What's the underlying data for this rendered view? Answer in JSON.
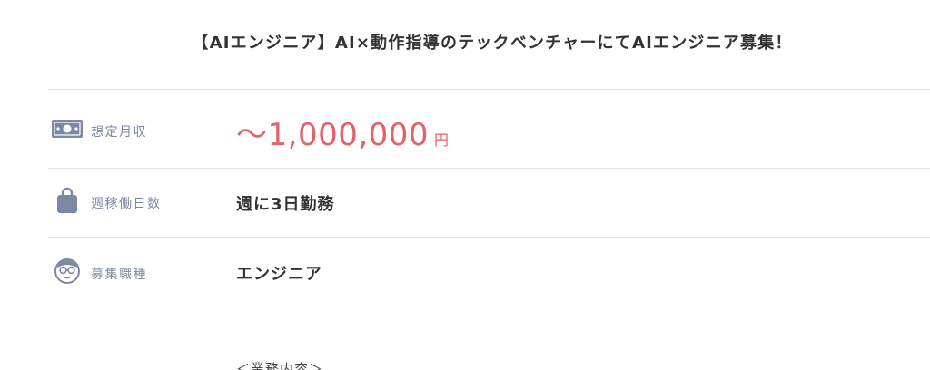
{
  "job_title": "【AIエンジニア】AI×動作指導のテックベンチャーにてAIエンジニア募集！",
  "details": {
    "salary": {
      "label": "想定月収",
      "amount": "〜1,000,000",
      "unit": "円",
      "icon": "money-bill-icon"
    },
    "working_days": {
      "label": "週稼働日数",
      "value": "週に3日勤務",
      "icon": "bag-icon"
    },
    "job_type": {
      "label": "募集職種",
      "value": "エンジニア",
      "icon": "person-glasses-icon"
    }
  },
  "section_heading": "＜業務内容＞",
  "colors": {
    "accent": "#e0626a",
    "label": "#7d88a4",
    "icon": "#7d88a4",
    "divider": "#e4e4e4"
  }
}
